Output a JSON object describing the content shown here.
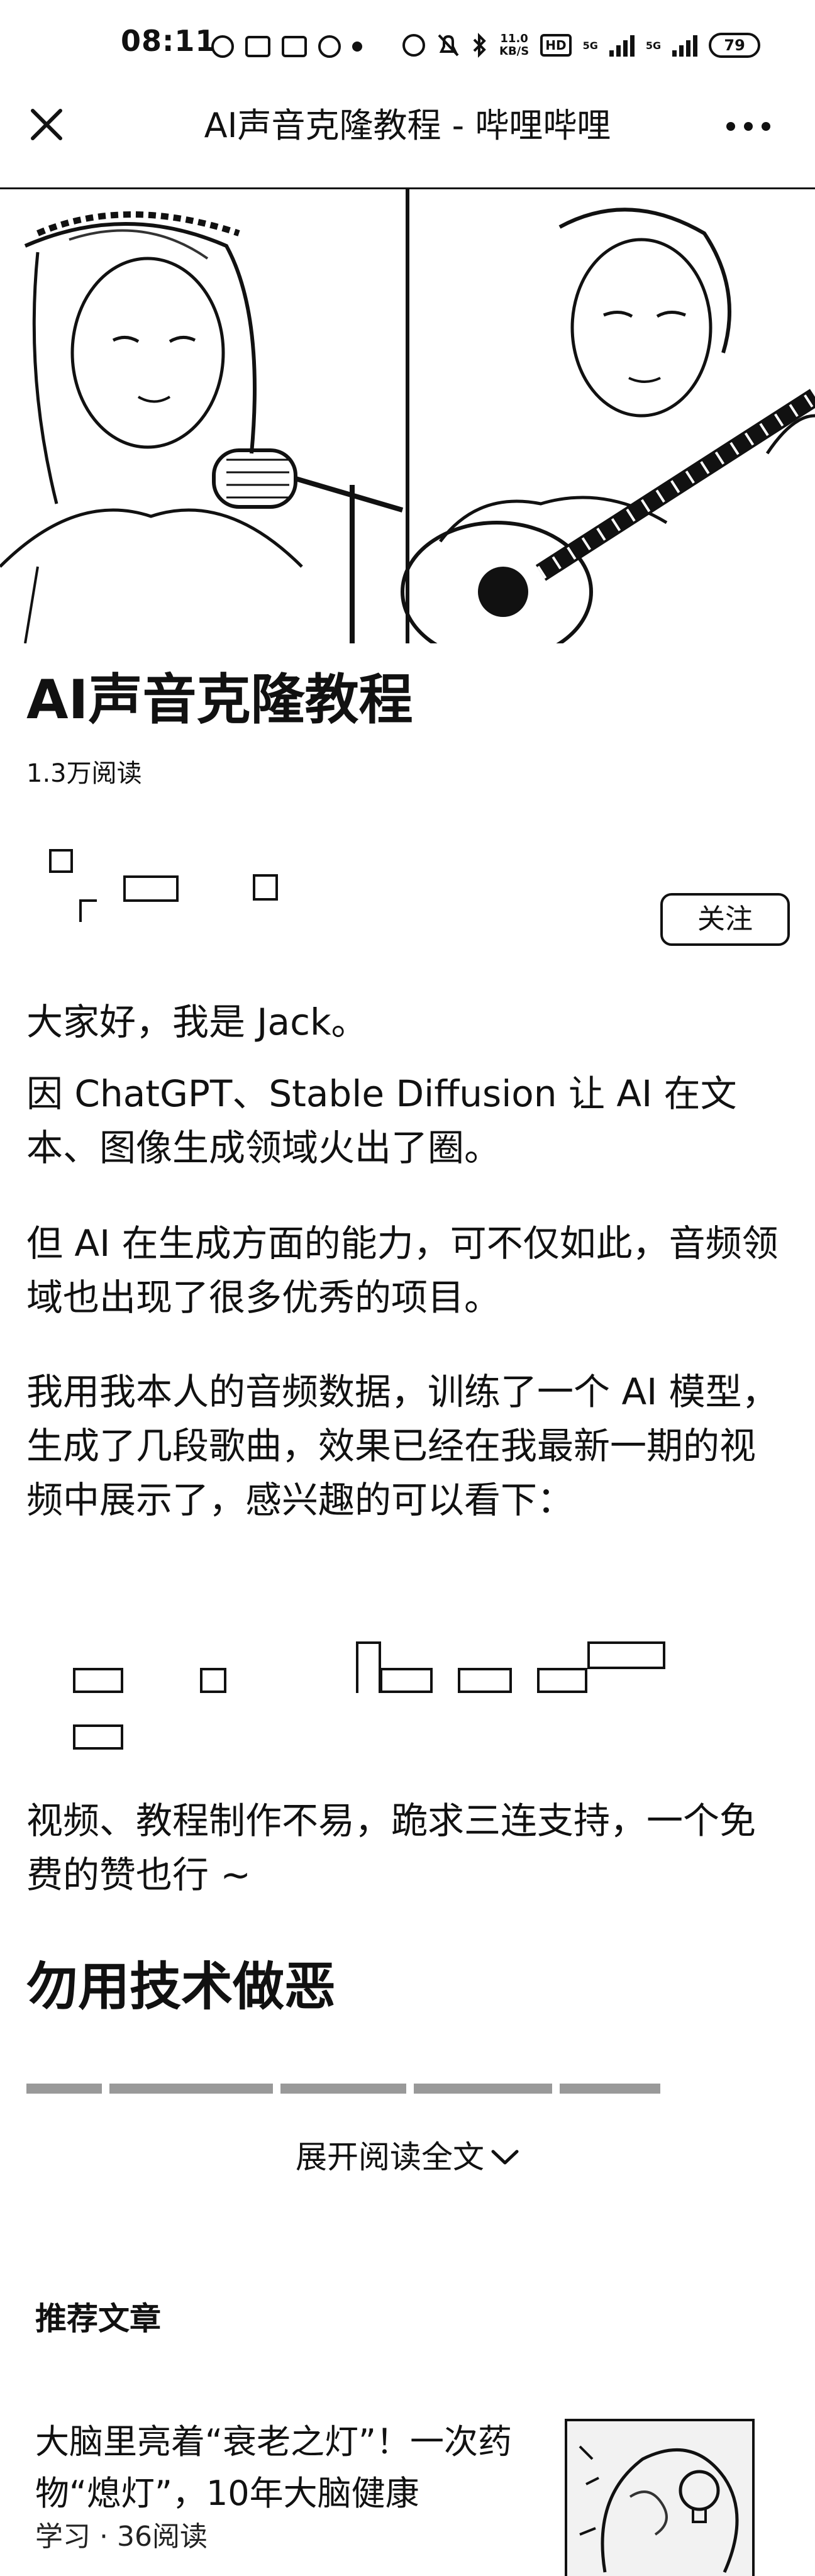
{
  "status_bar": {
    "time": "08:11",
    "net_speed_value": "11.0",
    "net_speed_unit": "KB/S",
    "hd_label": "HD",
    "signal_1": "5G",
    "signal_2": "5G",
    "battery": "79"
  },
  "nav": {
    "title": "AI声音克隆教程 - 哔哩哔哩"
  },
  "article": {
    "title": "AI声音克隆教程",
    "read_count": "1.3万阅读",
    "follow_label": "关注",
    "paragraphs": [
      "大家好，我是 Jack。",
      "因 ChatGPT、Stable Diffusion 让 AI 在文本、图像生成领域火出了圈。",
      "但 AI 在生成方面的能力，可不仅如此，音频领域也出现了很多优秀的项目。",
      "我用我本人的音频数据，训练了一个 AI 模型，生成了几段歌曲，效果已经在我最新一期的视频中展示了，感兴趣的可以看下：",
      "视频、教程制作不易，跪求三连支持，一个免费的赞也行 ~"
    ],
    "section_heading": "勿用技术做恶",
    "expand_label": "展开阅读全文"
  },
  "recommended": {
    "heading": "推荐文章",
    "items": [
      {
        "title": "大脑里亮着“衰老之灯”！一次药物“熄灯”，10年大脑健康",
        "meta": "学习 · 36阅读"
      }
    ]
  }
}
